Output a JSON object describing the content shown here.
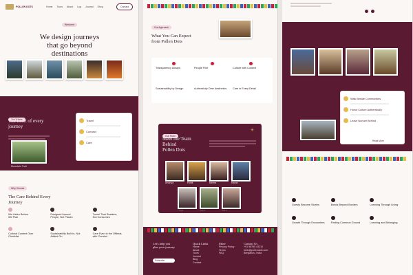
{
  "site": {
    "logo_text": "POLLEN DOTS",
    "nav": [
      "Home",
      "Tours",
      "About",
      "Log",
      "Journal",
      "Shop"
    ],
    "cta": "Contact"
  },
  "hero": {
    "headline_1": "We design journeys",
    "headline_2": "that go beyond",
    "headline_3": "destinations",
    "chip": "Welcome"
  },
  "heart": {
    "chip": "Our Values",
    "title": "The heart of every journey",
    "items": [
      "Travel",
      "Connect",
      "Care"
    ],
    "photo_caption": "Mountain Trail"
  },
  "care": {
    "chip": "Why Choose",
    "title_1": "The Care Behind Every",
    "title_2": "Journey",
    "cards": [
      {
        "t1": "We Listen Before",
        "t2": "We Plan"
      },
      {
        "t1": "Designed Around",
        "t2": "People, Not Places"
      },
      {
        "t1": "Travel That Sustains,",
        "t2": "Not Consumes"
      },
      {
        "t1": "Cultural Context Over",
        "t2": "Checklist"
      },
      {
        "t1": "Sustainability Built In, Not",
        "t2": "Added On"
      },
      {
        "t1": "Care Even in the Offbeat,",
        "t2": "with Comfort"
      }
    ]
  },
  "expect": {
    "chip": "Our Approach",
    "title_1": "What You Can Expect",
    "title_2": "from Pollen Dots",
    "cards": [
      "Transparency Always",
      "People First",
      "Culture with Context",
      "Sustainability by Design",
      "Authenticity Over Aesthetics",
      "Care in Every Detail"
    ]
  },
  "team": {
    "chip": "Our Team",
    "title_1": "Meet the Team",
    "title_2": "Behind",
    "title_3": "Pollen Dots",
    "members": [
      "Ananya",
      "Rohit",
      "Meera",
      "Karan",
      "Priya",
      "Arjun",
      "Sara"
    ]
  },
  "footer": {
    "tagline_1": "Let's help you",
    "tagline_2": "plan your journey",
    "col1": "Quick Links",
    "col2": "More",
    "col3": "Contact Us",
    "links1": [
      "Home",
      "About",
      "Tours",
      "Journal",
      "Blog",
      "Contact"
    ],
    "links2": [
      "Privacy Policy",
      "Terms",
      "FAQ"
    ],
    "contact": [
      "+91 98765 43210",
      "hello@pollendots.com",
      "Bengaluru, India"
    ],
    "subscribe": "Subscribe"
  },
  "community": {
    "items": [
      "Walk Beside Communities",
      "Honor Culture Authentically",
      "Leave Nurture Behind"
    ],
    "button": "Read More"
  },
  "features": {
    "cards": [
      "Guests Become Stories",
      "Bonds Beyond Borders",
      "Learning Through Living",
      "Growth Through Encounters",
      "Finding Common Ground",
      "Learning and Belonging"
    ]
  },
  "colors": {
    "primary": "#5a1a31",
    "accent": "#e9b94a",
    "bg": "#fbf7f4"
  }
}
